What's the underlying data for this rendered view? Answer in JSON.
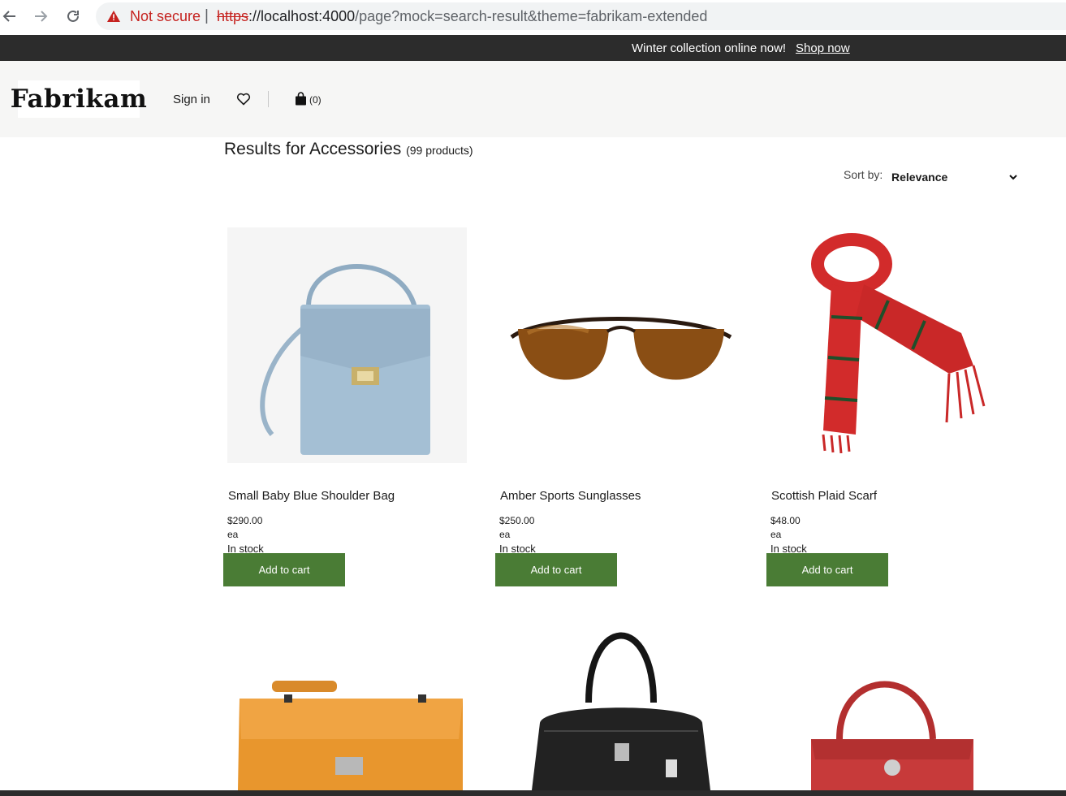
{
  "browser": {
    "security_label": "Not secure",
    "separator": "|",
    "url_protocol": "https",
    "url_host": "://localhost:4000",
    "url_rest": "/page?mock=search-result&theme=fabrikam-extended"
  },
  "promo": {
    "text": "Winter collection online now!",
    "link_label": "Shop now"
  },
  "header": {
    "logo_text": "Fabrikam",
    "signin_label": "Sign in",
    "cart_count": "(0)"
  },
  "results": {
    "title": "Results for Accessories",
    "count": "(99 products)",
    "sort_label": "Sort by:",
    "sort_value": "Relevance"
  },
  "products": [
    {
      "name": "Small Baby Blue Shoulder Bag",
      "price": "$290.00",
      "unit": "ea",
      "stock": "In stock",
      "button": "Add to cart"
    },
    {
      "name": "Amber Sports Sunglasses",
      "price": "$250.00",
      "unit": "ea",
      "stock": "In stock",
      "button": "Add to cart"
    },
    {
      "name": "Scottish Plaid Scarf",
      "price": "$48.00",
      "unit": "ea",
      "stock": "In stock",
      "button": "Add to cart"
    }
  ],
  "colors": {
    "banner": "#2c2c2c",
    "header_bg": "#f6f6f5",
    "button": "#4a7c35",
    "warning": "#c5221f"
  }
}
